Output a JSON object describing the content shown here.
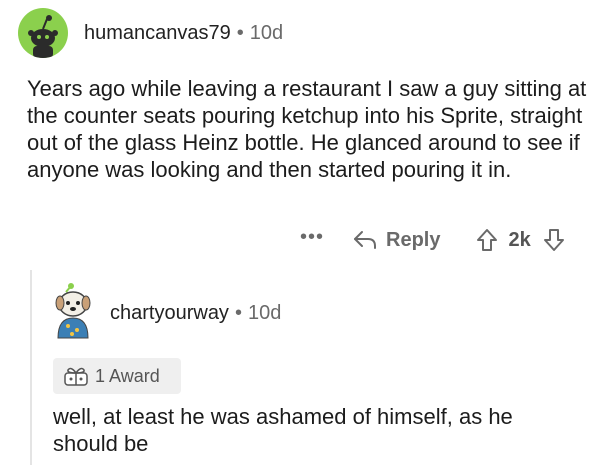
{
  "comments": [
    {
      "username": "humancanvas79",
      "separator": "•",
      "age": "10d",
      "avatar_icon": "snoo-avatar-icon",
      "avatar_color": "#8bd04d",
      "body": "Years ago while leaving a restaurant I saw a guy sitting at the counter seats pouring ketchup into his Sprite, straight out of the glass Heinz bottle. He glanced around to see if anyone was looking and then started pouring it in.",
      "actions": {
        "more": "•••",
        "reply_label": "Reply",
        "vote_count": "2k"
      }
    },
    {
      "username": "chartyourway",
      "separator": "•",
      "age": "10d",
      "avatar_icon": "dog-avatar-icon",
      "award_label": "1 Award",
      "body": "well, at least he was ashamed of himself, as he should be"
    }
  ]
}
